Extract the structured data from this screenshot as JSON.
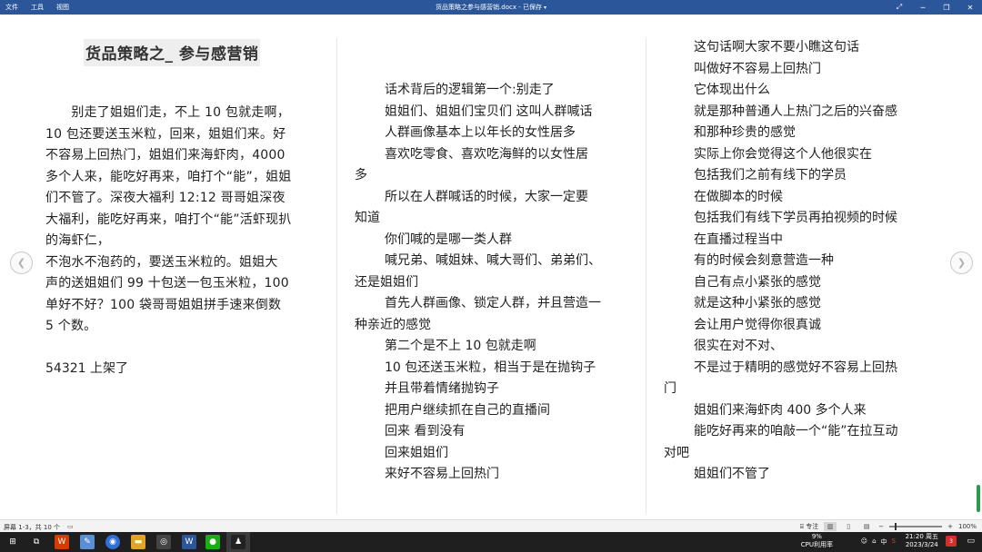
{
  "titlebar": {
    "menu": [
      "文件",
      "工具",
      "视图"
    ],
    "doc_title": "货品策略之参与感营销.docx - 已保存"
  },
  "document": {
    "heading": "货品策略之_ 参与感营销",
    "col1": {
      "para1": [
        "　　别走了姐姐们走，不上 10 包就走啊，",
        "10 包还要送玉米粒，回来，姐姐们来。好",
        "不容易上回热门，姐姐们来海虾肉，4000",
        "多个人来，能吃好再来，咱打个“能”，姐姐",
        "们不管了。深夜大福利 12:12 哥哥姐深夜",
        "大福利，能吃好再来，咱打个“能”活虾现扒",
        "的海虾仁，",
        "不泡水不泡药的，要送玉米粒的。姐姐大",
        "声的送姐姐们 99 十包送一包玉米粒，100",
        "单好不好？100 袋哥哥姐姐拼手速来倒数",
        "5 个数。"
      ],
      "para2": "54321 上架了"
    },
    "col2": [
      {
        "t": "话术背后的逻辑第一个:别走了",
        "i": true
      },
      {
        "t": "姐姐们、姐姐们宝贝们 这叫人群喊话",
        "i": true
      },
      {
        "t": "人群画像基本上以年长的女性居多",
        "i": true
      },
      {
        "t": "喜欢吃零食、喜欢吃海鲜的以女性居",
        "i": true
      },
      {
        "t": "多",
        "i": false
      },
      {
        "t": "所以在人群喊话的时候，大家一定要",
        "i": true
      },
      {
        "t": "知道",
        "i": false
      },
      {
        "t": "你们喊的是哪一类人群",
        "i": true
      },
      {
        "t": "喊兄弟、喊姐妹、喊大哥们、弟弟们、",
        "i": true
      },
      {
        "t": "还是姐姐们",
        "i": false
      },
      {
        "t": "首先人群画像、锁定人群，并且营造一",
        "i": true
      },
      {
        "t": "种亲近的感觉",
        "i": false
      },
      {
        "t": "第二个是不上 10 包就走啊",
        "i": true
      },
      {
        "t": "10 包还送玉米粒，相当于是在抛钩子",
        "i": true
      },
      {
        "t": "并且带着情绪抛钩子",
        "i": true
      },
      {
        "t": "把用户继续抓在自己的直播间",
        "i": true
      },
      {
        "t": "回来 看到没有",
        "i": true
      },
      {
        "t": "回来姐姐们",
        "i": true
      },
      {
        "t": "来好不容易上回热门",
        "i": true
      }
    ],
    "col3": [
      {
        "t": "这句话啊大家不要小瞧这句话",
        "i": true
      },
      {
        "t": "叫做好不容易上回热门",
        "i": true
      },
      {
        "t": "它体现出什么",
        "i": true
      },
      {
        "t": "就是那种普通人上热门之后的兴奋感",
        "i": true
      },
      {
        "t": "和那种珍贵的感觉",
        "i": true
      },
      {
        "t": "实际上你会觉得这个人他很实在",
        "i": true
      },
      {
        "t": "包括我们之前有线下的学员",
        "i": true
      },
      {
        "t": "在做脚本的时候",
        "i": true
      },
      {
        "t": "包括我们有线下学员再拍视频的时候",
        "i": true
      },
      {
        "t": "在直播过程当中",
        "i": true
      },
      {
        "t": "有的时候会刻意营造一种",
        "i": true
      },
      {
        "t": "自己有点小紧张的感觉",
        "i": true
      },
      {
        "t": "就是这种小紧张的感觉",
        "i": true
      },
      {
        "t": "会让用户觉得你很真诚",
        "i": true
      },
      {
        "t": "很实在对不对、",
        "i": true
      },
      {
        "t": "不是过于精明的感觉好不容易上回热",
        "i": true
      },
      {
        "t": "门",
        "i": false
      },
      {
        "t": "姐姐们来海虾肉 400 多个人来",
        "i": true
      },
      {
        "t": "能吃好再来的咱敲一个“能”在拉互动",
        "i": true
      },
      {
        "t": "对吧",
        "i": false
      },
      {
        "t": "姐姐们不管了",
        "i": true
      }
    ]
  },
  "statusbar": {
    "page_info": "屏幕 1-3，共 10 个",
    "focus_label": "专注",
    "zoom": "100%"
  },
  "taskbar": {
    "cpu_value": "9%",
    "cpu_label": "CPU利用率",
    "ime": "中",
    "time": "21:20 周五",
    "date": "2023/3/24",
    "badge": "3"
  },
  "colors": {
    "titlebar": "#2b579a",
    "taskbar": "#1f1f1f",
    "scroll_marker": "#2b9a4a"
  }
}
